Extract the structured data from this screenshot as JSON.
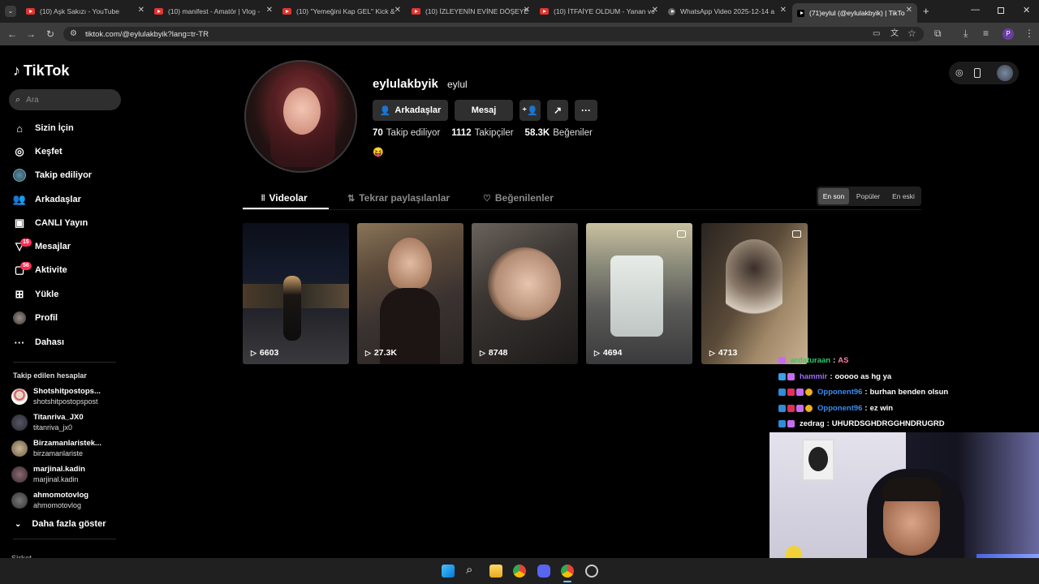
{
  "browser": {
    "tabs": [
      {
        "title": "(10) Aşk Sakızı - YouTube"
      },
      {
        "title": "(10) manifest - Amatör | Vlog -"
      },
      {
        "title": "(10) \"Yemeğini Kap GEL\" Kick &"
      },
      {
        "title": "(10) İZLEYENİN EVİNE DÖŞEYE"
      },
      {
        "title": "(10) İTFAİYE OLDUM - Yanan ve"
      },
      {
        "title": "WhatsApp Video 2025-12-14 a"
      },
      {
        "title": "(71)eylul (@eylulakbyik) | TikTo"
      }
    ],
    "address": "tiktok.com/@eylulakbyik?lang=tr-TR"
  },
  "sidebar": {
    "logo": "TikTok",
    "search_placeholder": "Ara",
    "nav": [
      {
        "label": "Sizin İçin",
        "icon": "home-icon"
      },
      {
        "label": "Keşfet",
        "icon": "compass-icon"
      },
      {
        "label": "Takip ediliyor",
        "icon": "following-avatar-icon"
      },
      {
        "label": "Arkadaşlar",
        "icon": "friends-icon"
      },
      {
        "label": "CANLI Yayın",
        "icon": "live-icon"
      },
      {
        "label": "Mesajlar",
        "icon": "messages-icon",
        "badge": "15"
      },
      {
        "label": "Aktivite",
        "icon": "activity-icon",
        "badge": "56"
      },
      {
        "label": "Yükle",
        "icon": "upload-icon"
      },
      {
        "label": "Profil",
        "icon": "profile-avatar-icon"
      },
      {
        "label": "Dahası",
        "icon": "more-icon"
      }
    ],
    "following_header": "Takip edilen hesaplar",
    "following": [
      {
        "name": "Shotshitpostops...",
        "handle": "shotshitpostopspost"
      },
      {
        "name": "Titanriva_JX0",
        "handle": "titanriva_jx0"
      },
      {
        "name": "Birzamanlaristek...",
        "handle": "birzamanlariste"
      },
      {
        "name": "marjinal.kadin",
        "handle": "marjinal.kadin"
      },
      {
        "name": "ahmomotovlog",
        "handle": "ahmomotovlog"
      }
    ],
    "show_more": "Daha fazla göster",
    "cut_label": "Şirket"
  },
  "profile": {
    "username": "eylulakbyik",
    "nickname": "eylul",
    "buttons": {
      "friends": "Arkadaşlar",
      "message": "Mesaj"
    },
    "stats": {
      "following_count": "70",
      "following_label": "Takip ediliyor",
      "followers_count": "1112",
      "followers_label": "Takipçiler",
      "likes_count": "58.3K",
      "likes_label": "Beğeniler"
    },
    "bio_emoji": "😝",
    "tabs": [
      {
        "label": "Videolar"
      },
      {
        "label": "Tekrar paylaşılanlar"
      },
      {
        "label": "Beğenilenler"
      }
    ],
    "sort": [
      "En son",
      "Popüler",
      "En eski"
    ],
    "videos": [
      {
        "views": "6603",
        "pinned": false
      },
      {
        "views": "27.3K",
        "pinned": false
      },
      {
        "views": "8748",
        "pinned": false
      },
      {
        "views": "4694",
        "pinned": true
      },
      {
        "views": "4713",
        "pinned": true
      }
    ]
  },
  "chat": [
    {
      "user": "ardaturaan",
      "message": "AS",
      "color": "#32c86e"
    },
    {
      "user": "hammir",
      "message": "ooooo as hg ya",
      "color": "#9c6cf5"
    },
    {
      "user": "Opponent96",
      "message": "burhan benden olsun",
      "color": "#3c8cf0"
    },
    {
      "user": "Opponent96",
      "message": "ez win",
      "color": "#3c8cf0"
    },
    {
      "user": "zedrag",
      "message": "UHURDSGHDRGGHNDRUGRD",
      "color": "#ffffff"
    }
  ]
}
